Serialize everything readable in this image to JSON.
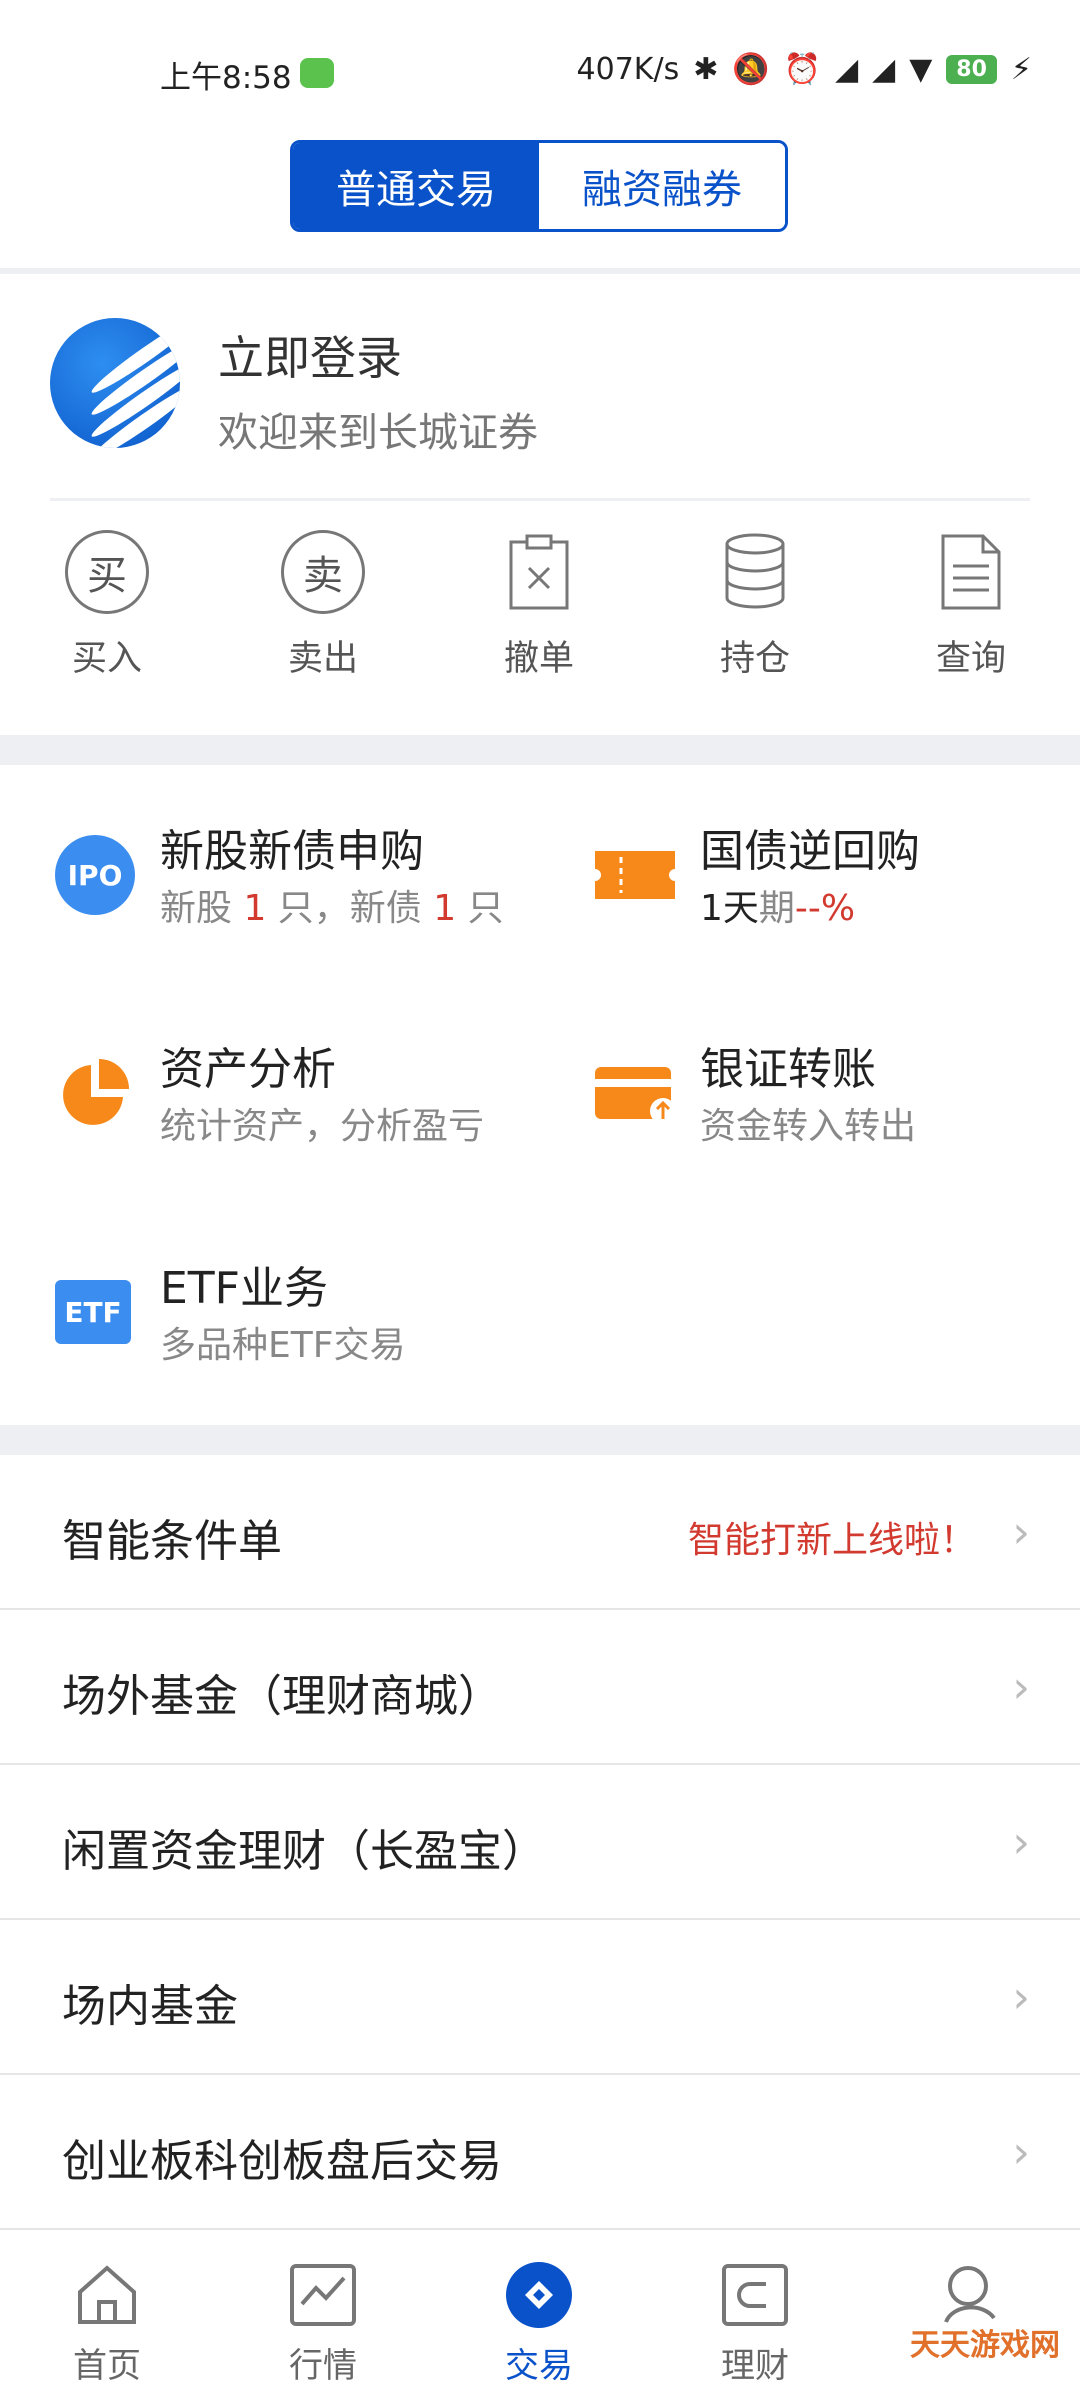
{
  "status_bar": {
    "time": "上午8:58",
    "speed": "407K/s",
    "battery": "80"
  },
  "segment": {
    "normal": "普通交易",
    "margin": "融资融券"
  },
  "login": {
    "title": "立即登录",
    "subtitle": "欢迎来到长城证券"
  },
  "actions": [
    {
      "label": "买入",
      "glyph": "买"
    },
    {
      "label": "卖出",
      "glyph": "卖"
    },
    {
      "label": "撤单"
    },
    {
      "label": "持仓"
    },
    {
      "label": "查询"
    }
  ],
  "grid": {
    "ipo": {
      "icon_text": "IPO",
      "title": "新股新债申购",
      "s1": "新股 ",
      "n1": "1",
      "s2": " 只，新债 ",
      "n2": "1",
      "s3": " 只"
    },
    "repo": {
      "title": "国债逆回购",
      "s1": "1天",
      "s2": "期",
      "s3": "--%"
    },
    "assets": {
      "title": "资产分析",
      "sub": "统计资产，分析盈亏"
    },
    "bank": {
      "title": "银证转账",
      "sub": "资金转入转出"
    },
    "etf": {
      "icon_text": "ETF",
      "title": "ETF业务",
      "sub": "多品种ETF交易"
    }
  },
  "list": [
    {
      "title": "智能条件单",
      "hint": "智能打新上线啦！"
    },
    {
      "title": "场外基金（理财商城）"
    },
    {
      "title": "闲置资金理财（长盈宝）"
    },
    {
      "title": "场内基金"
    },
    {
      "title": "创业板科创板盘后交易"
    }
  ],
  "nav": [
    "首页",
    "行情",
    "交易",
    "理财",
    "我的"
  ],
  "watermark": "天天游戏网",
  "colors": {
    "accent": "#0a52c9",
    "orange": "#f7891b",
    "red": "#d23a2f"
  }
}
